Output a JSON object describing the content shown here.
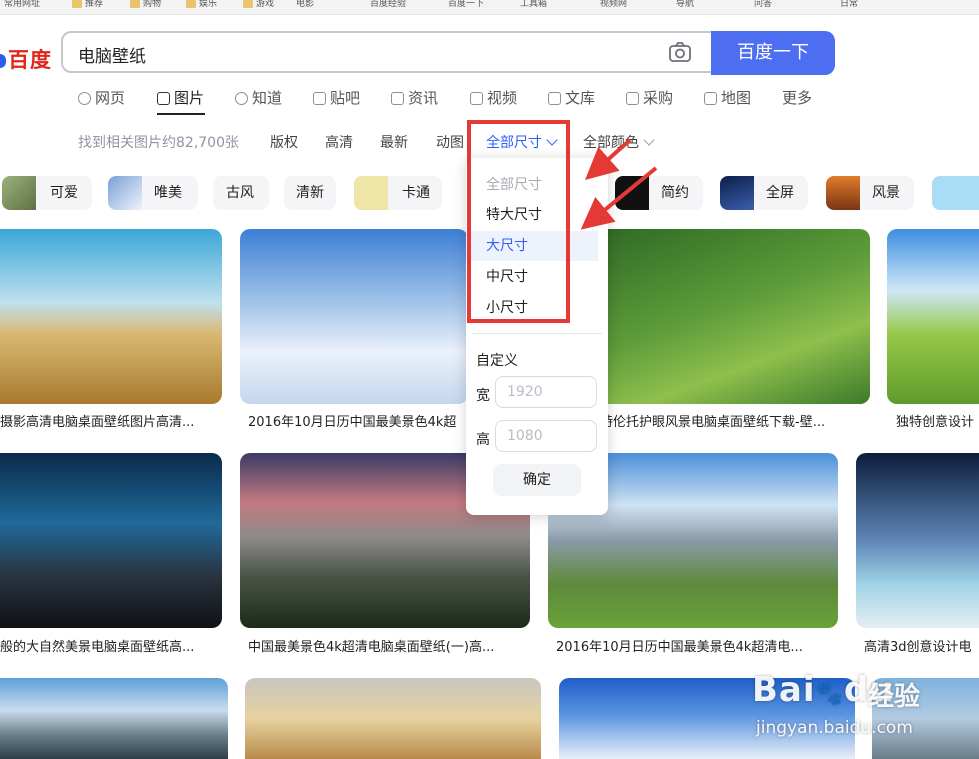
{
  "bookmarks": [
    "常用网址",
    "推荐",
    "购物",
    "娱乐",
    "游戏",
    "电影",
    "百度经验",
    "百度一下",
    "工具箱",
    "视频网",
    "导航",
    "问答",
    "日常"
  ],
  "logo": "百度",
  "search": {
    "query": "电脑壁纸",
    "button": "百度一下"
  },
  "nav": [
    {
      "label": "网页",
      "icon": "search-icon"
    },
    {
      "label": "图片",
      "icon": "image-icon"
    },
    {
      "label": "知道",
      "icon": "question-icon"
    },
    {
      "label": "贴吧",
      "icon": "tieba-icon"
    },
    {
      "label": "资讯",
      "icon": "news-icon"
    },
    {
      "label": "视频",
      "icon": "video-icon"
    },
    {
      "label": "文库",
      "icon": "doc-icon"
    },
    {
      "label": "采购",
      "icon": "cart-icon"
    },
    {
      "label": "地图",
      "icon": "map-icon"
    },
    {
      "label": "更多",
      "icon": ""
    }
  ],
  "filters": {
    "result_count": "找到相关图片约82,700张",
    "items": [
      "版权",
      "高清",
      "最新",
      "动图"
    ],
    "size": "全部尺寸",
    "color": "全部颜色"
  },
  "chips": [
    "可爱",
    "唯美",
    "古风",
    "清新",
    "卡通",
    "简约",
    "全屏",
    "风景"
  ],
  "size_dropdown": {
    "options": [
      "全部尺寸",
      "特大尺寸",
      "大尺寸",
      "中尺寸",
      "小尺寸"
    ],
    "custom_label": "自定义",
    "width_label": "宽",
    "width_placeholder": "1920",
    "height_label": "高",
    "height_placeholder": "1080",
    "confirm": "确定"
  },
  "captions": {
    "r1c1": "摄影高清电脑桌面壁纸图片高清...",
    "r1c2": "2016年10月日历中国最美景色4k超",
    "r1c3": "特伦托护眼风景电脑桌面壁纸下载-壁...",
    "r1c4": "独特创意设计",
    "r2c1": "般的大自然美景电脑桌面壁纸高...",
    "r2c2": "中国最美景色4k超清电脑桌面壁纸(一)高...",
    "r2c3": "2016年10月日历中国最美景色4k超清电...",
    "r2c4": "高清3d创意设计电"
  },
  "watermark": {
    "brand": "Bai",
    "brand2": "du",
    "cn": "经验",
    "url": "jingyan.baidu.com"
  },
  "colors": {
    "accent": "#4e6ef2",
    "link": "#315efb",
    "highlight_box": "#e53935"
  }
}
